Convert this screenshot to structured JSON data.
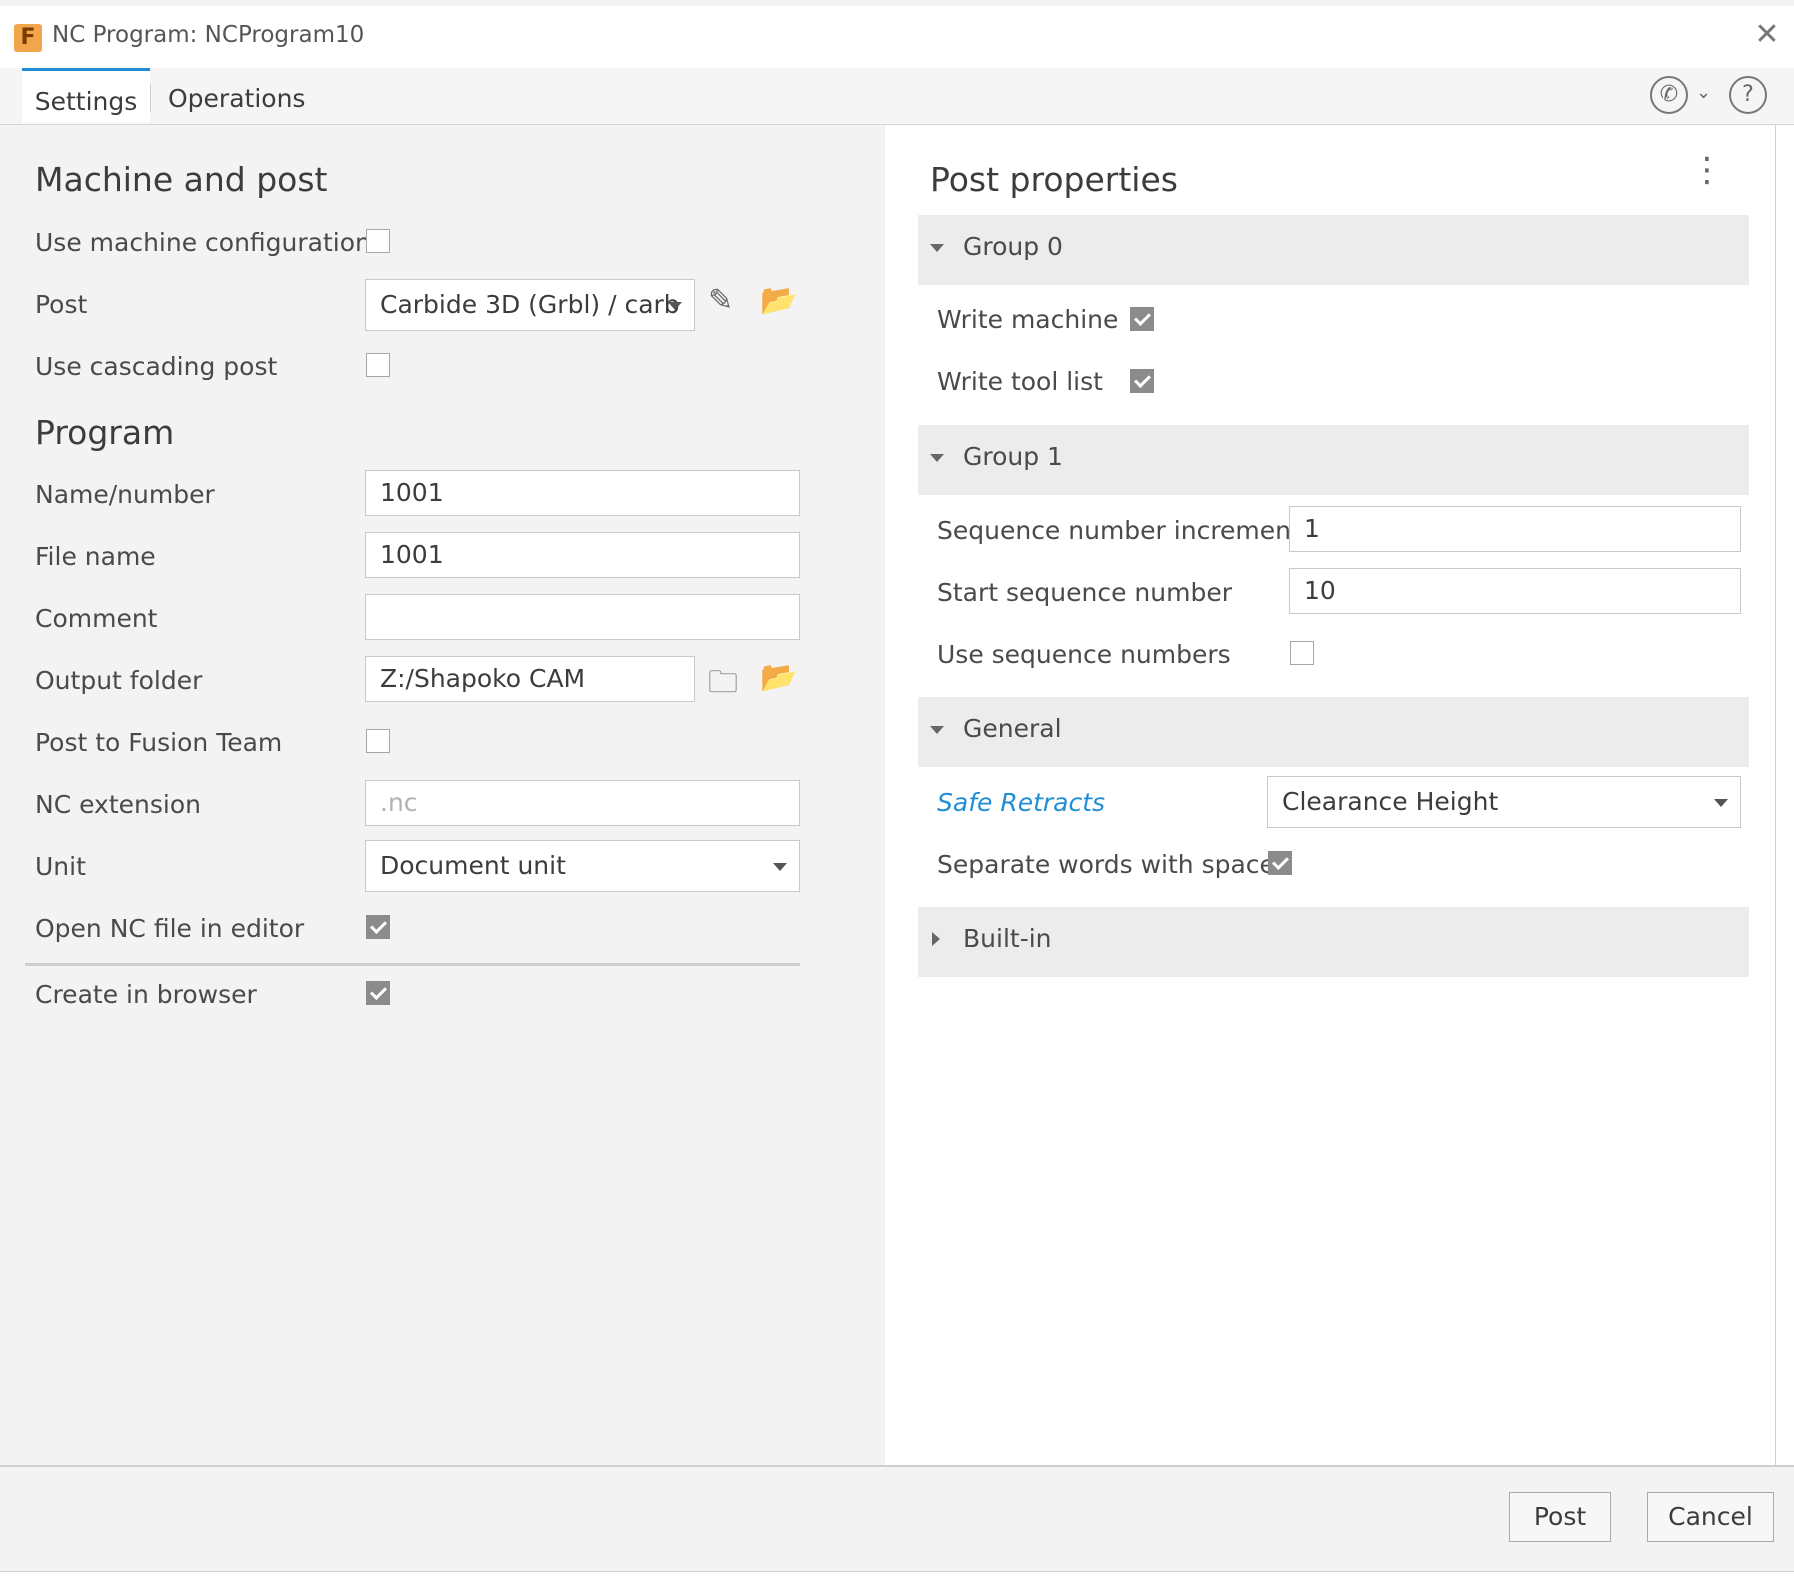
{
  "window": {
    "title": "NC Program: NCProgram10",
    "app_icon_letter": "F"
  },
  "tabs": [
    {
      "label": "Settings",
      "active": true
    },
    {
      "label": "Operations",
      "active": false
    }
  ],
  "left": {
    "machine_section_title": "Machine and post",
    "use_machine_config_label": "Use machine configuration",
    "use_machine_config_checked": false,
    "post_label": "Post",
    "post_value": "Carbide 3D (Grbl) / carb",
    "use_cascading_label": "Use cascading post",
    "use_cascading_checked": false,
    "program_section_title": "Program",
    "name_label": "Name/number",
    "name_value": "1001",
    "filename_label": "File name",
    "filename_value": "1001",
    "comment_label": "Comment",
    "comment_value": "",
    "output_folder_label": "Output folder",
    "output_folder_value": "Z:/Shapoko CAM",
    "post_team_label": "Post to Fusion Team",
    "post_team_checked": false,
    "nc_ext_label": "NC extension",
    "nc_ext_placeholder": ".nc",
    "unit_label": "Unit",
    "unit_value": "Document unit",
    "open_editor_label": "Open NC file in editor",
    "open_editor_checked": true,
    "create_browser_label": "Create in browser",
    "create_browser_checked": true
  },
  "right": {
    "title": "Post properties",
    "group0": {
      "label": "Group 0",
      "write_machine_label": "Write machine",
      "write_machine_checked": true,
      "write_tool_list_label": "Write tool list",
      "write_tool_list_checked": true
    },
    "group1": {
      "label": "Group 1",
      "seq_increment_label": "Sequence number increment",
      "seq_increment_value": "1",
      "start_seq_label": "Start sequence number",
      "start_seq_value": "10",
      "use_seq_label": "Use sequence numbers",
      "use_seq_checked": false
    },
    "general": {
      "label": "General",
      "safe_retracts_label": "Safe Retracts",
      "safe_retracts_value": "Clearance Height",
      "separate_words_label": "Separate words with space",
      "separate_words_checked": true
    },
    "builtin": {
      "label": "Built-in"
    }
  },
  "footer": {
    "post_label": "Post",
    "cancel_label": "Cancel"
  },
  "colors": {
    "accent": "#1f8ed6",
    "left_bg": "#f3f3f3",
    "group_bg": "#ececec"
  }
}
